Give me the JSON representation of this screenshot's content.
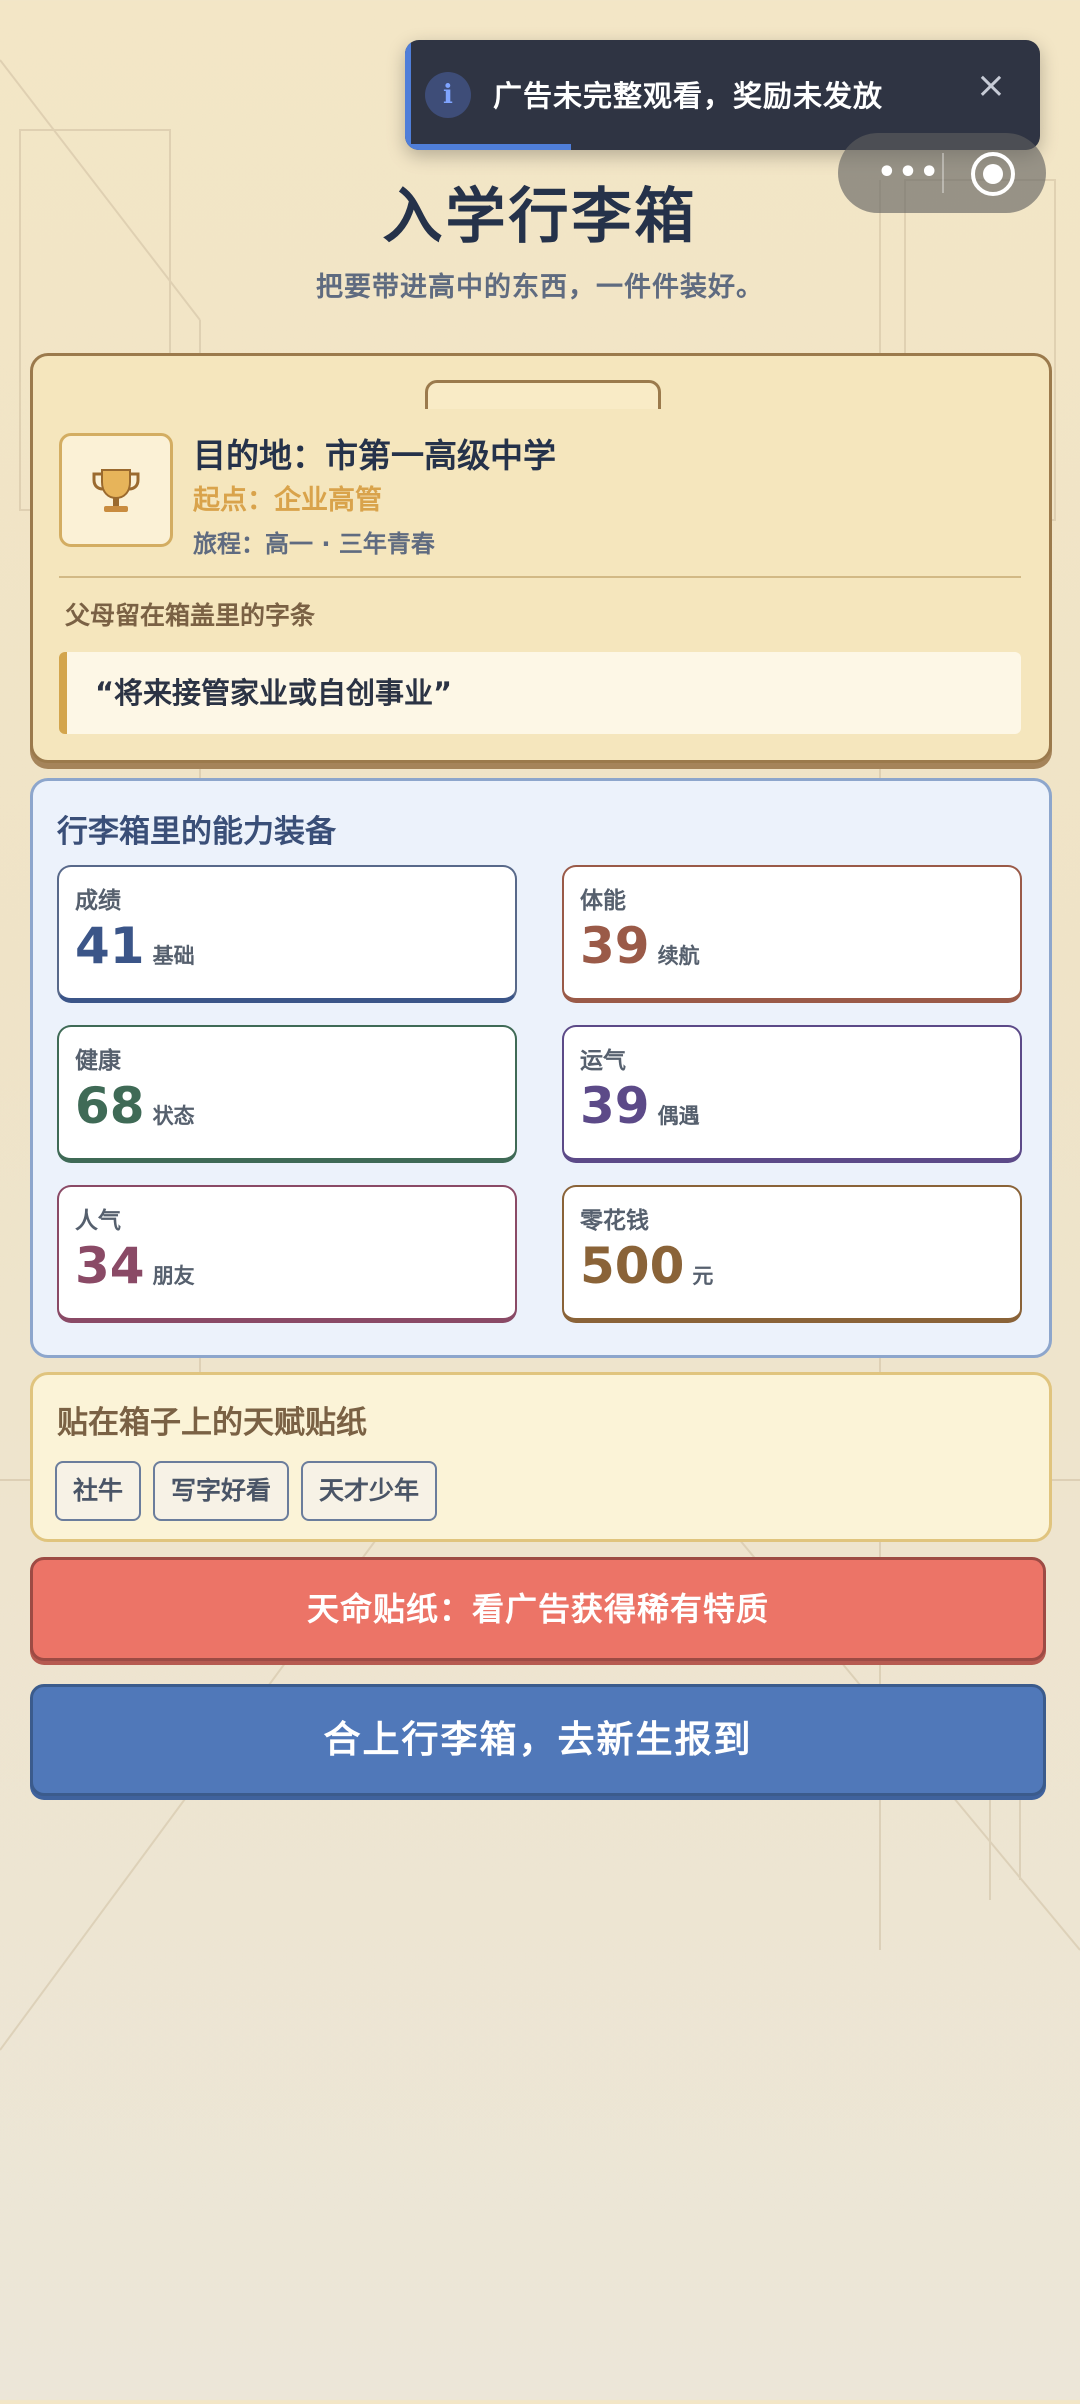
{
  "toast": {
    "message": "广告未完整观看，奖励未发放",
    "close_symbol": "×",
    "info_symbol": "i"
  },
  "capsule": {
    "more_symbol": "•••"
  },
  "header": {
    "title": "入学行李箱",
    "subtitle": "把要带进高中的东西，一件件装好。"
  },
  "destination": {
    "icon": "trophy-icon",
    "line1": "目的地：市第一高级中学",
    "line2": "起点：企业高管",
    "line3": "旅程：高一 · 三年青春",
    "note_label": "父母留在箱盖里的字条",
    "note_quote": "“将来接管家业或自创事业”"
  },
  "abilities": {
    "heading": "行李箱里的能力装备",
    "stats": [
      {
        "label": "成绩",
        "value": "41",
        "unit": "基础",
        "color": "#3b5588"
      },
      {
        "label": "体能",
        "value": "39",
        "unit": "续航",
        "color": "#9a5a48"
      },
      {
        "label": "健康",
        "value": "68",
        "unit": "状态",
        "color": "#3f6a56"
      },
      {
        "label": "运气",
        "value": "39",
        "unit": "偶遇",
        "color": "#5c4a88"
      },
      {
        "label": "人气",
        "value": "34",
        "unit": "朋友",
        "color": "#8a4a66"
      },
      {
        "label": "零花钱",
        "value": "500",
        "unit": "元",
        "color": "#8a6338"
      }
    ]
  },
  "talents": {
    "heading": "贴在箱子上的天赋贴纸",
    "tags": [
      "社牛",
      "写字好看",
      "天才少年"
    ]
  },
  "buttons": {
    "ad_sticker": "天命贴纸：看广告获得稀有特质",
    "report": "合上行李箱，去新生报到"
  }
}
